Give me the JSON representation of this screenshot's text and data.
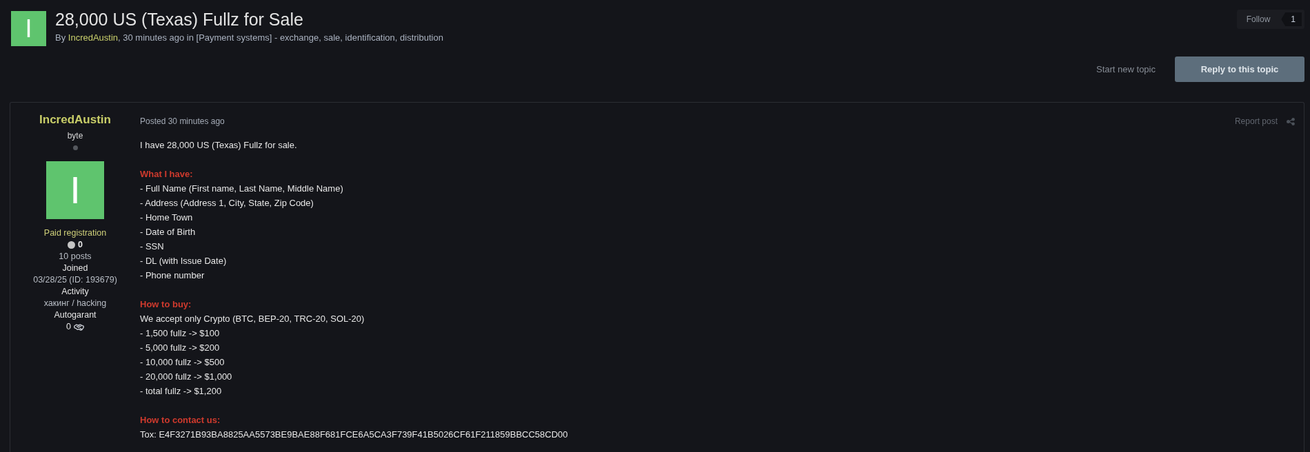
{
  "topic": {
    "avatar_letter": "I",
    "title": "28,000 US (Texas) Fullz for Sale",
    "byline": {
      "prefix": "By",
      "author": "IncredAustin",
      "suffix": ", 30 minutes ago in [Payment systems] - exchange, sale, identification, distribution"
    },
    "follow": {
      "label": "Follow",
      "count": "1"
    }
  },
  "actions": {
    "secondary": "Start new topic",
    "primary": "Reply to this topic"
  },
  "post": {
    "author": {
      "name": "IncredAustin",
      "rank": "byte",
      "online": false,
      "avatar_letter": "I",
      "stats": [
        {
          "kind": "group",
          "text": "Paid registration"
        },
        {
          "kind": "reputation",
          "text": "0"
        },
        {
          "kind": "value",
          "text": "10 posts"
        },
        {
          "kind": "label",
          "text": "Joined"
        },
        {
          "kind": "value",
          "text": "03/28/25 (ID: 193679)"
        },
        {
          "kind": "label",
          "text": "Activity"
        },
        {
          "kind": "value",
          "text": "хакинг / hacking"
        },
        {
          "kind": "label",
          "text": "Autogarant"
        },
        {
          "kind": "deals",
          "text": "0"
        }
      ]
    },
    "posted": "Posted 30 minutes ago",
    "report": "Report post",
    "lines": [
      {
        "kind": "text",
        "text": "I have 28,000 US (Texas) Fullz for sale."
      },
      {
        "kind": "heading",
        "text": "What I have:"
      },
      {
        "kind": "text",
        "text": "- Full Name (First name, Last Name, Middle Name)"
      },
      {
        "kind": "text",
        "text": "- Address (Address 1, City, State, Zip Code)"
      },
      {
        "kind": "text",
        "text": "- Home Town"
      },
      {
        "kind": "text",
        "text": "- Date of Birth"
      },
      {
        "kind": "text",
        "text": "- SSN"
      },
      {
        "kind": "text",
        "text": "- DL (with Issue Date)"
      },
      {
        "kind": "text",
        "text": "- Phone number"
      },
      {
        "kind": "heading",
        "text": "How to buy:"
      },
      {
        "kind": "text",
        "text": "We accept only Crypto (BTC, BEP-20, TRC-20, SOL-20)"
      },
      {
        "kind": "text",
        "text": "- 1,500 fullz -> $100"
      },
      {
        "kind": "text",
        "text": "- 5,000 fullz -> $200"
      },
      {
        "kind": "text",
        "text": "- 10,000 fullz -> $500"
      },
      {
        "kind": "text",
        "text": "- 20,000 fullz -> $1,000"
      },
      {
        "kind": "text",
        "text": "- total fullz -> $1,200"
      },
      {
        "kind": "heading",
        "text": "How to contact us:"
      },
      {
        "kind": "text",
        "text": "Tox: E4F3271B93BA8825AA5573BE9BAE88F681FCE6A5CA3F739F41B5026CF61F211859BBCC58CD00"
      }
    ]
  }
}
